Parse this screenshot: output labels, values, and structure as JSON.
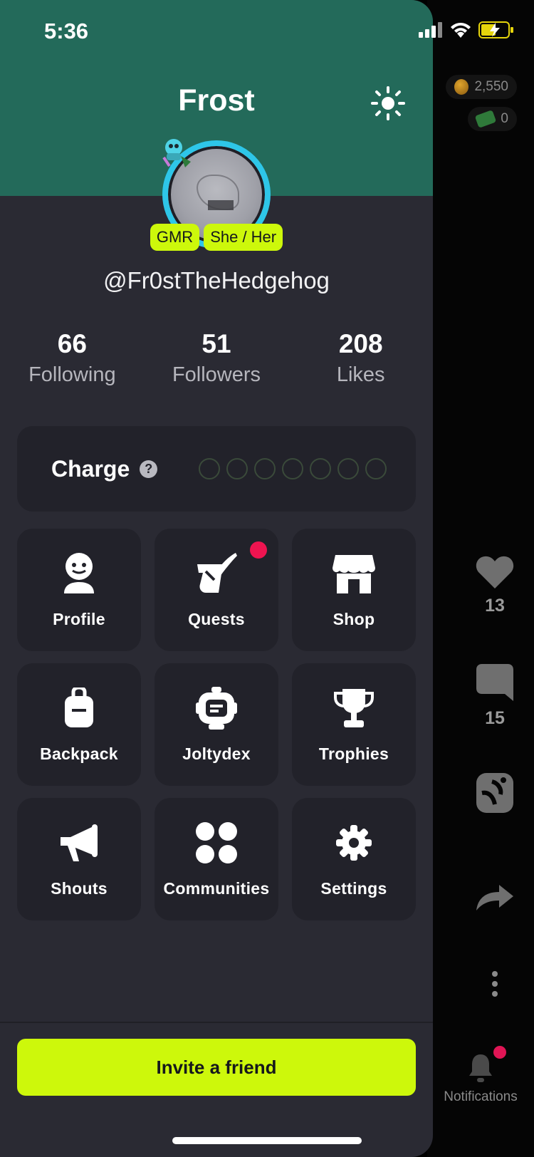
{
  "status_bar": {
    "time": "5:36"
  },
  "header": {
    "title": "Frost"
  },
  "profile": {
    "badges": [
      "GMR",
      "She / Her"
    ],
    "handle": "@Fr0stTheHedgehog"
  },
  "stats": [
    {
      "value": "66",
      "label": "Following"
    },
    {
      "value": "51",
      "label": "Followers"
    },
    {
      "value": "208",
      "label": "Likes"
    }
  ],
  "charge": {
    "label": "Charge",
    "help": "?",
    "level": 0,
    "max": 7
  },
  "menu": [
    {
      "label": "Profile",
      "icon": "profile-icon"
    },
    {
      "label": "Quests",
      "icon": "quests-icon",
      "notification": true
    },
    {
      "label": "Shop",
      "icon": "shop-icon"
    },
    {
      "label": "Backpack",
      "icon": "backpack-icon"
    },
    {
      "label": "Joltydex",
      "icon": "joltydex-icon"
    },
    {
      "label": "Trophies",
      "icon": "trophy-icon"
    },
    {
      "label": "Shouts",
      "icon": "megaphone-icon"
    },
    {
      "label": "Communities",
      "icon": "communities-icon"
    },
    {
      "label": "Settings",
      "icon": "gear-icon"
    }
  ],
  "invite": {
    "label": "Invite a friend"
  },
  "wallet": {
    "coins": "2,550",
    "cash": "0"
  },
  "video_actions": {
    "likes": "13",
    "comments": "15",
    "notifications_label": "Notifications"
  },
  "colors": {
    "header": "#236a5a",
    "drawer": "#2a2a33",
    "tile": "#22222a",
    "accent": "#cdf80b",
    "avatar_ring": "#2ec6e8",
    "alert": "#ee1450"
  }
}
